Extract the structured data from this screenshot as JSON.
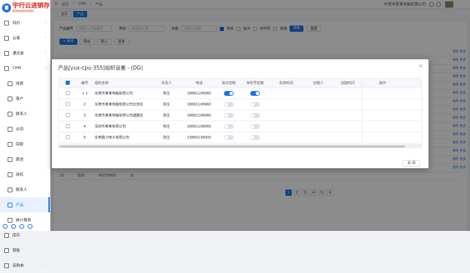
{
  "app": {
    "logo_main": "宇行云进销存",
    "logo_sub": "更简单省钱的进销存"
  },
  "sidebar": {
    "items": [
      {
        "label": "待办",
        "icon": "home-icon",
        "sub": false
      },
      {
        "label": "云客",
        "icon": "cloud-icon",
        "sub": false
      },
      {
        "label": "通讯录",
        "icon": "contacts-icon",
        "sub": false
      },
      {
        "label": "CRM",
        "icon": "crm-icon",
        "sub": false
      },
      {
        "label": "线索",
        "icon": "lead-icon",
        "sub": true
      },
      {
        "label": "客户",
        "icon": "customer-icon",
        "sub": true
      },
      {
        "label": "联系人",
        "icon": "contact-icon",
        "sub": true
      },
      {
        "label": "合同",
        "icon": "contract-icon",
        "sub": true
      },
      {
        "label": "回款",
        "icon": "payment-icon",
        "sub": true
      },
      {
        "label": "跟进",
        "icon": "followup-icon",
        "sub": true
      },
      {
        "label": "商机",
        "icon": "opportunity-icon",
        "sub": true
      },
      {
        "label": "联系人",
        "icon": "contact-icon",
        "sub": true
      },
      {
        "label": "产品",
        "icon": "product-icon",
        "sub": true,
        "active": true
      },
      {
        "label": "统计报表",
        "icon": "report-icon",
        "sub": true
      },
      {
        "label": "库存",
        "icon": "inventory-icon",
        "sub": false
      },
      {
        "label": "销售",
        "icon": "sales-icon",
        "sub": false
      },
      {
        "label": "采购单",
        "icon": "purchase-icon",
        "sub": false
      }
    ]
  },
  "topbar": {
    "crumbs": [
      "首页",
      "CRM",
      "产品"
    ],
    "company": "东莞市某某电脑有限公司"
  },
  "tabs": [
    {
      "label": "首页",
      "active": false
    },
    {
      "label": "产品",
      "active": true
    }
  ],
  "filter": {
    "product_code_label": "产品编号",
    "product_code_placeholder": "请输入产品编号",
    "category_label": "类别",
    "category_placeholder": "请选择分类",
    "keyword_label": "关键",
    "keyword_placeholder": "请输入关键",
    "opt_1": "有效",
    "opt_2": "批次",
    "opt_3": "序列号",
    "opt_4": "其他",
    "search_label": "搜索",
    "reset_label": "重置"
  },
  "toolbar": {
    "new_label": "+ 新增",
    "export_label": "导出",
    "import_label": "导入",
    "more_label": "更多"
  },
  "background": {
    "bottom_row": [
      "18",
      "配材",
      "ADF3068S",
      "台"
    ],
    "op_label": "修改 更多",
    "pages": [
      "1",
      "2",
      "3",
      "4",
      "5",
      "6"
    ]
  },
  "modal": {
    "title": "产品[yux-cpu-355]组织设置 - (DG)",
    "close": "×",
    "headers": [
      "编号",
      "组织名称",
      "负责人",
      "电话",
      "批次控制",
      "序列号控制",
      "失效时间",
      "创建人",
      "创建时间",
      "操作"
    ],
    "rows": [
      {
        "no": "1",
        "expand": "+",
        "org": "东莞市某某电脑有限公司",
        "owner": "陈生",
        "phone": "18681108960",
        "batch": true,
        "serial": true
      },
      {
        "no": "2",
        "expand": "",
        "org": "东莞市某某电脑有限公司长安店",
        "owner": "陈生",
        "phone": "18681108960",
        "batch": false,
        "serial": false
      },
      {
        "no": "3",
        "expand": "",
        "org": "东莞市某某电脑有限公司塘厦店",
        "owner": "陈生",
        "phone": "18681108960",
        "batch": false,
        "serial": false
      },
      {
        "no": "4",
        "expand": "",
        "org": "深圳市某某有限公司",
        "owner": "陈生",
        "phone": "18681108960",
        "batch": false,
        "serial": false
      },
      {
        "no": "5",
        "expand": "",
        "org": "东莞鑫力电子有限公司",
        "owner": "陈生",
        "phone": "13800138000",
        "batch": false,
        "serial": false
      }
    ],
    "footer_button": "关 闭"
  }
}
